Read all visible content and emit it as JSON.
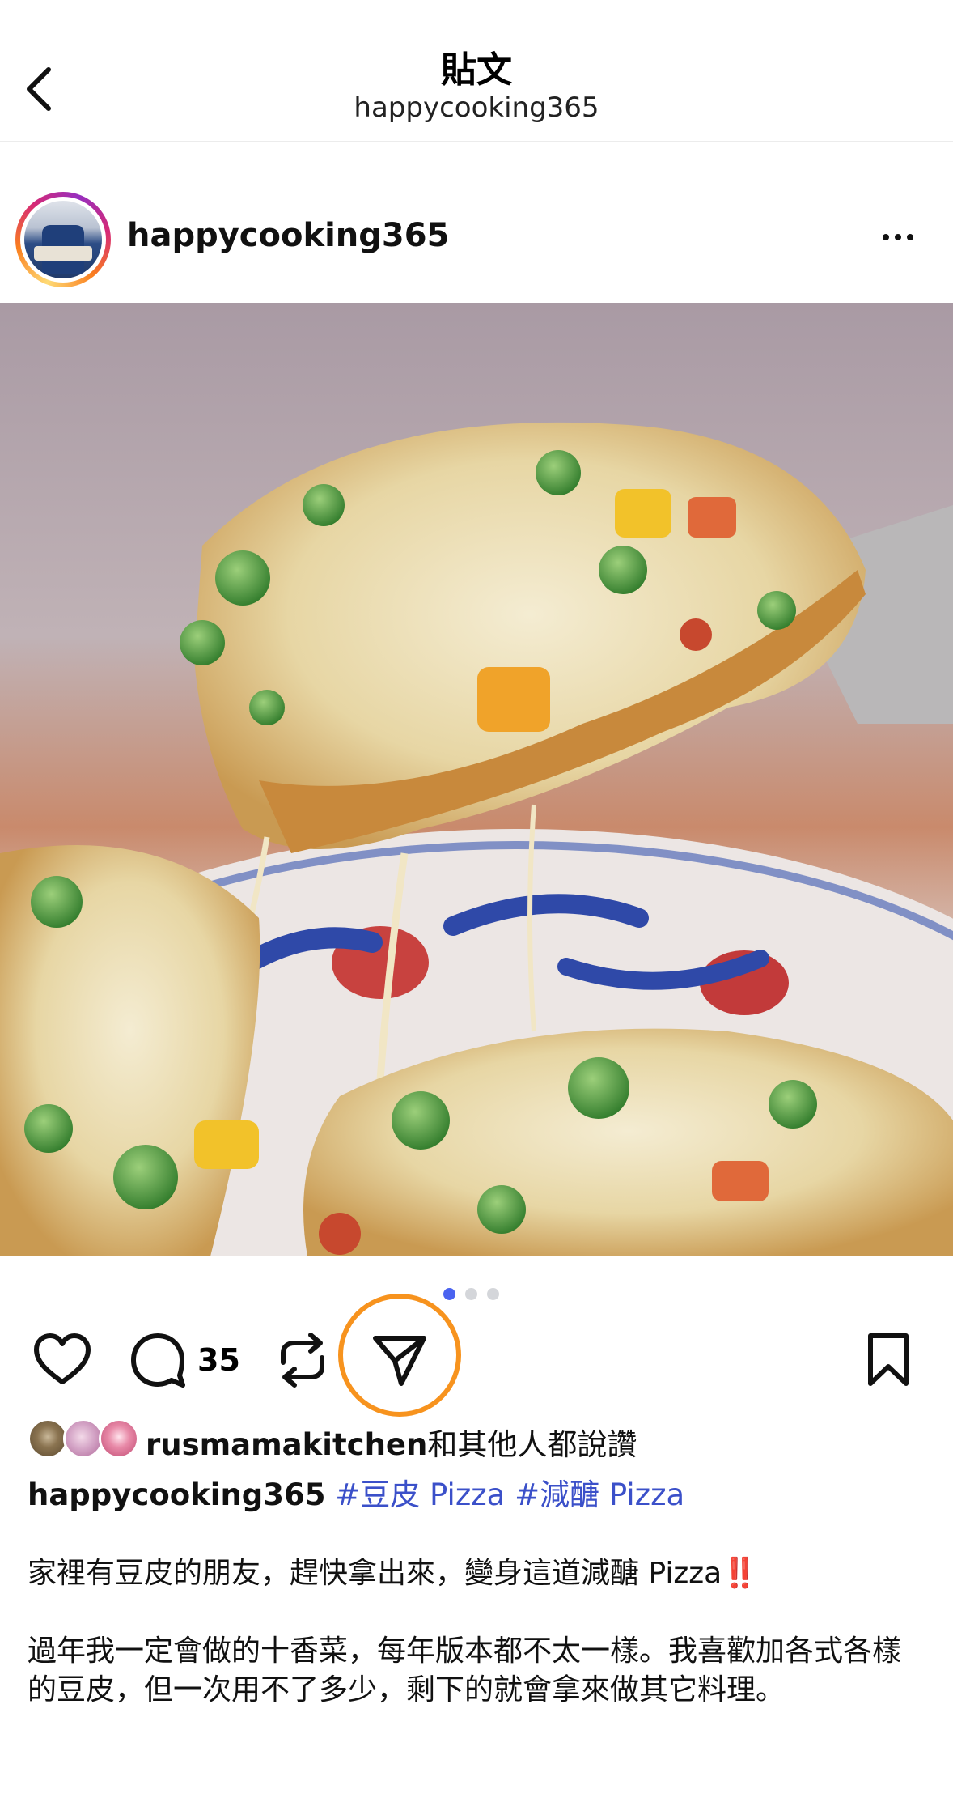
{
  "header": {
    "title": "貼文",
    "subtitle": "happycooking365"
  },
  "post": {
    "author": "happycooking365",
    "carousel": {
      "total": 3,
      "active": 1
    },
    "comment_count": "35",
    "likes": {
      "first_user": "rusmamakitchen",
      "suffix": "和其他人都說讚"
    },
    "caption": {
      "user": "happycooking365",
      "tags": [
        "#豆皮 Pizza",
        "#減醣 Pizza"
      ],
      "line1": "家裡有豆皮的朋友，趕快拿出來，變身這道減醣 Pizza",
      "line1_emoji": "‼️",
      "para2": "過年我一定會做的十香菜，每年版本都不太一樣。我喜歡加各式各樣的豆皮，但一次用不了多少，剩下的就會拿來做其它料理。"
    }
  },
  "colors": {
    "link": "#3b50c9",
    "highlight": "#f7931e",
    "dot_active": "#4a63f0"
  },
  "icons": [
    "chevron-left-icon",
    "more-horizontal-icon",
    "heart-icon",
    "comment-icon",
    "repost-icon",
    "send-icon",
    "bookmark-icon"
  ]
}
